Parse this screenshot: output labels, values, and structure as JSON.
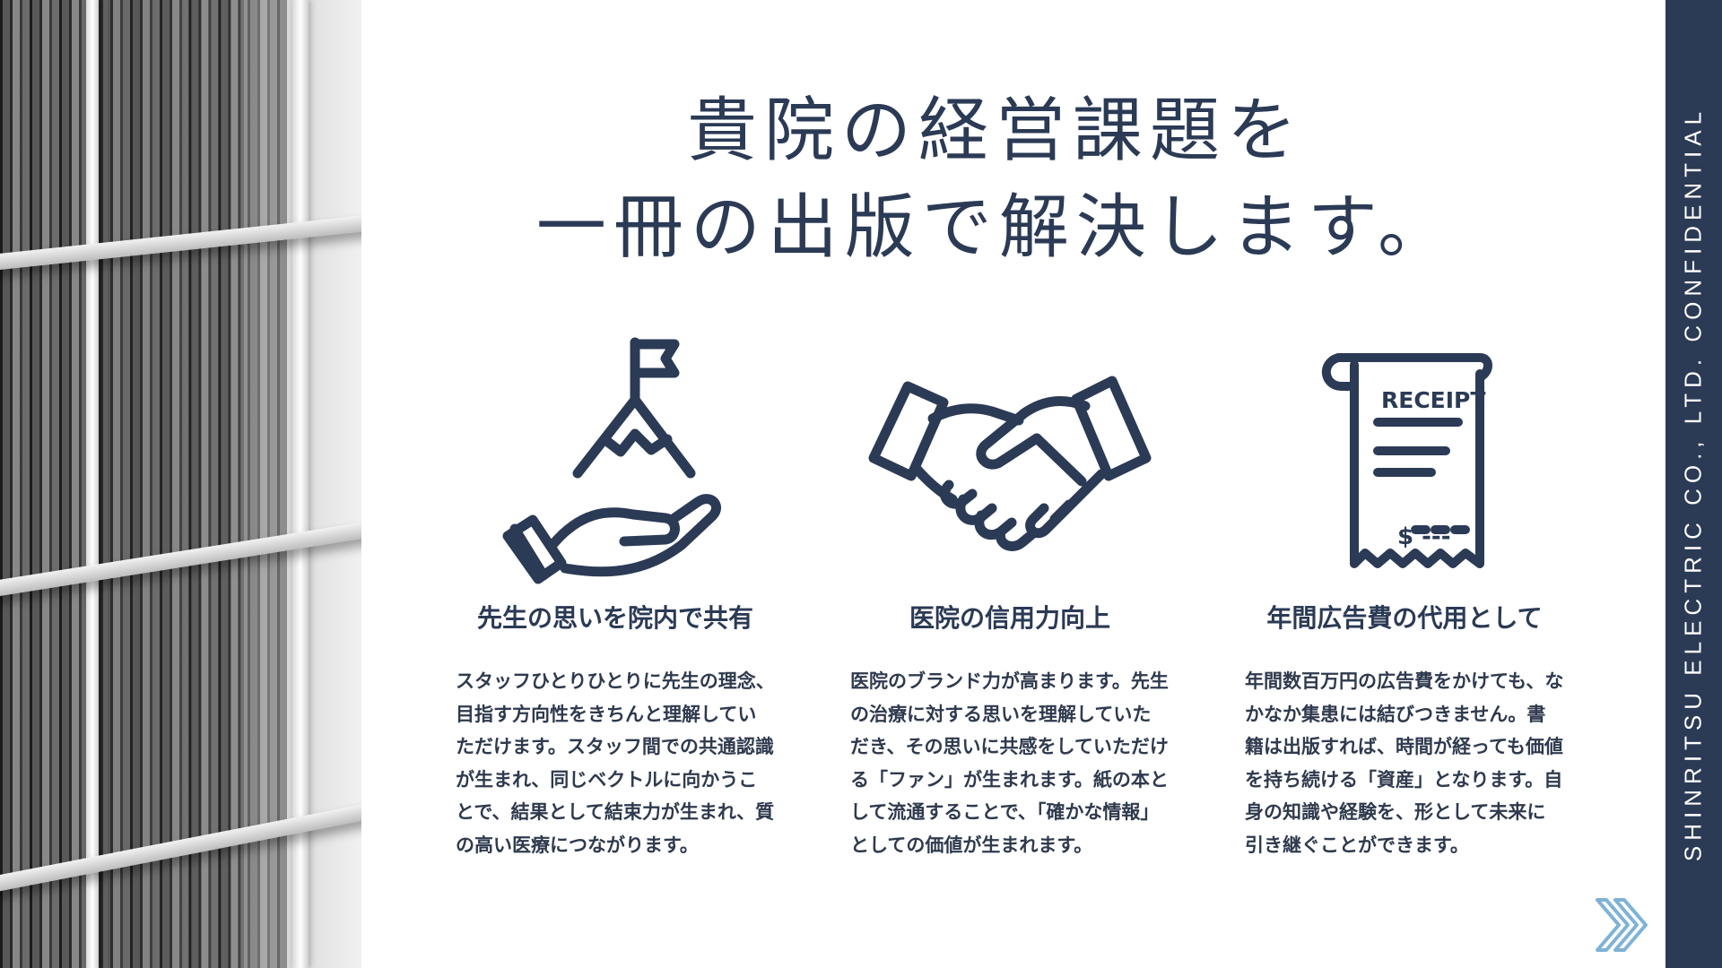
{
  "sidebar": {
    "company_text": "SHINRITSU ELECTRIC CO., LTD.  CONFIDENTIAL"
  },
  "headline": {
    "line1": "貴院の経営課題を",
    "line2": "一冊の出版で解決します。"
  },
  "columns": [
    {
      "icon": "hand-mountain-flag-icon",
      "title": "先生の思いを院内で共有",
      "text": "スタッフひとりひとりに先生の理念、目指す方向性をきちんと理解していただけます。スタッフ間での共通認識が生まれ、同じベクトルに向かうことで、結果として結束力が生まれ、質の高い医療につながります。"
    },
    {
      "icon": "handshake-icon",
      "title": "医院の信用力向上",
      "text": "医院のブランド力が高まります。先生の治療に対する思いを理解していただき、その思いに共感をしていただける「ファン」が生まれます。紙の本として流通することで、「確かな情報」としての価値が生まれます。"
    },
    {
      "icon": "receipt-icon",
      "title": "年間広告費の代用として",
      "text": "年間数百万円の広告費をかけても、なかなか集患には結びつきません。書籍は出版すれば、時間が経っても価値を持ち続ける「資産」となります。自身の知識や経験を、形として未来に引き継ぐことができます。",
      "receipt_label": "RECEIPT",
      "receipt_amount": "$ ---"
    }
  ],
  "colors": {
    "navy": "#2b3a55",
    "chevron": "#7fb3d5"
  },
  "nav": {
    "next_icon": "double-chevron-right-icon"
  }
}
